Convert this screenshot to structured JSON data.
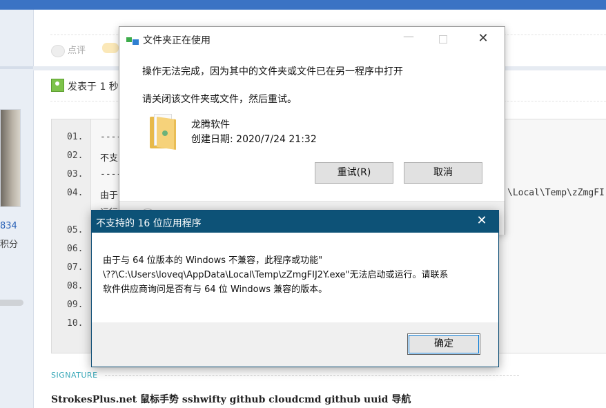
{
  "forum": {
    "left_number": "834",
    "left_label": "积分",
    "comment_label": "点评",
    "post_meta": "发表于 1 秒",
    "code_lines": [
      {
        "num": "01.",
        "text": "----"
      },
      {
        "num": "02.",
        "text": "不支"
      },
      {
        "num": "03.",
        "text": "----"
      },
      {
        "num": "04.",
        "text": "由于"
      },
      {
        "num": "05.",
        "text": ""
      },
      {
        "num": "06.",
        "text": ""
      },
      {
        "num": "07.",
        "text": ""
      },
      {
        "num": "08.",
        "text": ""
      },
      {
        "num": "09.",
        "text": ""
      },
      {
        "num": "10.",
        "text": ""
      }
    ],
    "code_line4_right": "\\Local\\Temp\\zZmgFI",
    "code_line4_cont": "运行",
    "signature_label": "SIGNATURE",
    "signature_links": "StrokesPlus.net 鼠标手势 sshwifty github cloudcmd github uuid 导航"
  },
  "dialog_in_use": {
    "title": "文件夹正在使用",
    "message1": "操作无法完成，因为其中的文件夹或文件已在另一程序中打开",
    "message2": "请关闭该文件夹或文件，然后重试。",
    "item_name": "龙腾软件",
    "item_date": "创建日期: 2020/7/24 21:32",
    "retry_label": "重试(R)",
    "cancel_label": "取消",
    "min_glyph": "—",
    "close_glyph": "✕"
  },
  "dialog_16bit": {
    "title": "不支持的 16 位应用程序",
    "close_glyph": "✕",
    "body_lines": [
      "由于与 64 位版本的 Windows 不兼容，此程序或功能\"",
      "\\??\\C:\\Users\\loveq\\AppData\\Local\\Temp\\zZmgFIJ2Y.exe\"无法启动或运行。请联系",
      "软件供应商询问是否有与 64 位 Windows 兼容的版本。"
    ],
    "ok_label": "确定"
  },
  "colors": {
    "dialog_titlebar": "#0d5277",
    "top_bar": "#3b73c4",
    "folder": "#f6d27a"
  }
}
